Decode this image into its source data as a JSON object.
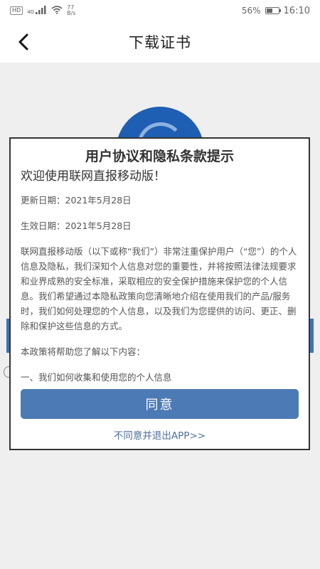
{
  "status_bar": {
    "hd": "HD",
    "network": "4G",
    "speed_value": "77",
    "speed_unit": "B/s",
    "battery_percent": "56%",
    "battery_level": 0.56,
    "time": "16:10"
  },
  "nav": {
    "title": "下载证书"
  },
  "dialog": {
    "title": "用户协议和隐私条款提示",
    "welcome": "欢迎使用联网直报移动版！",
    "update_date": "更新日期：2021年5月28日",
    "effective_date": "生效日期：2021年5月28日",
    "paragraph_1": "联网直报移动版（以下或称“我们”）非常注重保护用户（“您”）的个人信息及隐私，我们深知个人信息对您的重要性，并将按照法律法规要求和业界成熟的安全标准，采取相应的安全保护措施来保护您的个人信息。我们希望通过本隐私政策向您清晰地介绍在使用我们的产品/服务时，我们如何处理您的个人信息，以及我们为您提供的访问、更正、删除和保护这些信息的方式。",
    "paragraph_2": "本政策将帮助您了解以下内容：",
    "section_1": "一、我们如何收集和使用您的个人信息",
    "agree_label": "同意",
    "decline_label": "不同意并退出APP>>"
  },
  "colors": {
    "accent": "#4c7ab5",
    "logo_blue": "#1f5fb3"
  }
}
